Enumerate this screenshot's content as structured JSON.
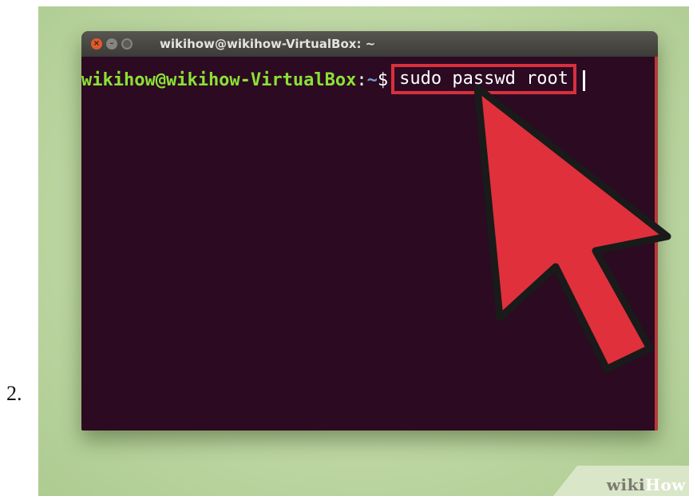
{
  "step": {
    "number": "2."
  },
  "window": {
    "title": "wikihow@wikihow-VirtualBox: ~",
    "buttons": {
      "close_icon": "close-icon",
      "minimize_icon": "minimize-icon",
      "maximize_icon": "maximize-icon"
    }
  },
  "terminal": {
    "prompt_user": "wikihow@wikihow-VirtualBox",
    "prompt_separator": ":",
    "prompt_path": "~",
    "prompt_symbol": "$",
    "command": "sudo passwd root",
    "colors": {
      "background": "#2c0a22",
      "user": "#8ae234",
      "path": "#729fcf",
      "highlight": "#d8303c"
    }
  },
  "pointer": {
    "icon": "cursor-arrow-icon",
    "color": "#e0303c"
  },
  "watermark": {
    "part1": "wiki",
    "part2": "How"
  }
}
